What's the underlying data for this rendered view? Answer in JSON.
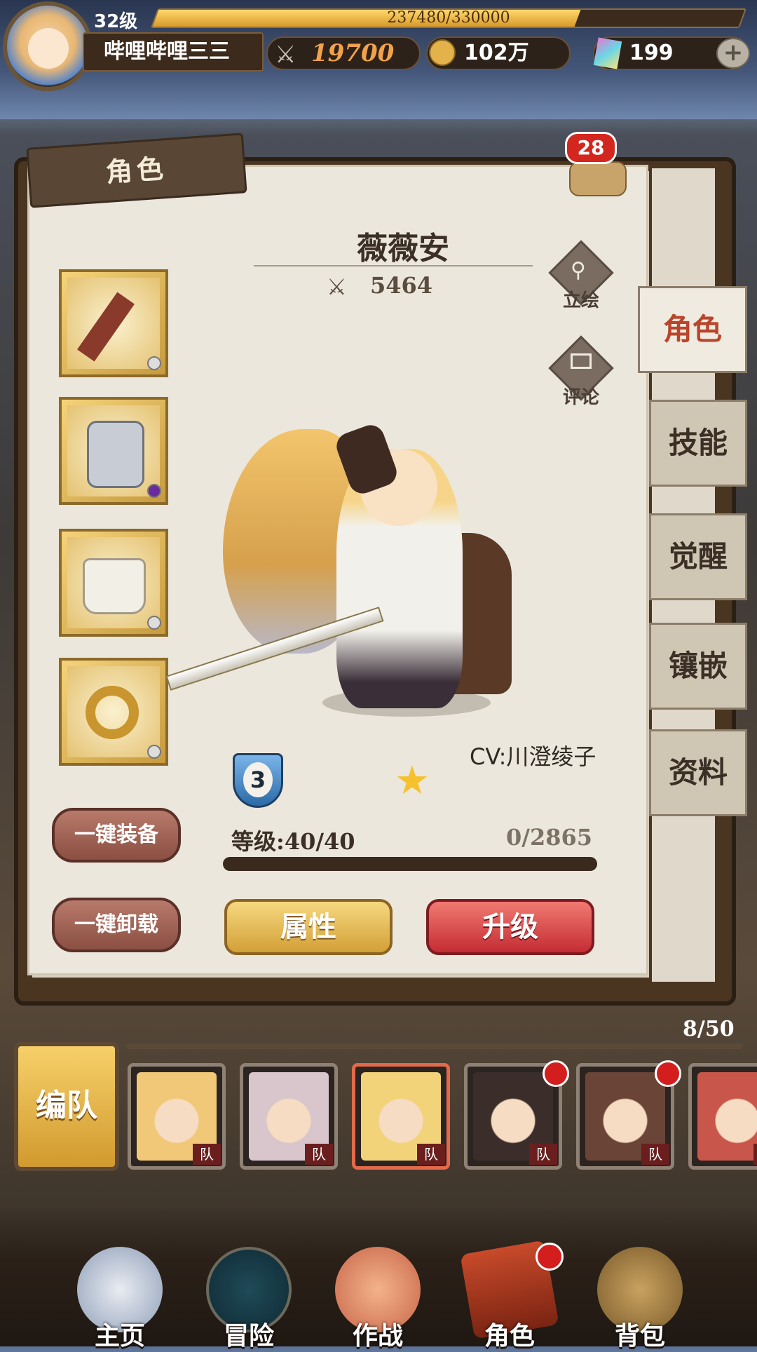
{
  "player": {
    "level": "32级",
    "exp_text": "237480/330000",
    "exp_fraction": 0.72,
    "name": "哔哩哔哩三三",
    "power": "19700",
    "gold": "102万",
    "gems": "199",
    "plus_label": "+"
  },
  "panel": {
    "title": "角色",
    "comment_count": "28",
    "char_name": "薇薇安",
    "char_power": "5464",
    "portrait_label": "立绘",
    "comment_label": "评论",
    "cv": "CV:川澄绫子",
    "rank": "3",
    "stars": 1,
    "level_text": "等级:40/40",
    "exp_text": "0/2865",
    "btn_equip_all": "一键装备",
    "btn_unequip_all": "一键卸载",
    "btn_attributes": "属性",
    "btn_upgrade": "升级"
  },
  "side_tabs": [
    "角色",
    "技能",
    "觉醒",
    "镶嵌",
    "资料"
  ],
  "roster": {
    "count": "8/50",
    "team_button": "编队",
    "team_tag": "队",
    "heroes": [
      {
        "color": "#f0c878",
        "badge": false,
        "selected": false
      },
      {
        "color": "#d8c6cc",
        "badge": false,
        "selected": false
      },
      {
        "color": "#f2d37a",
        "badge": false,
        "selected": true
      },
      {
        "color": "#3b2e2a",
        "badge": true,
        "selected": false
      },
      {
        "color": "#6a4436",
        "badge": true,
        "selected": false
      },
      {
        "color": "#c9564a",
        "badge": false,
        "selected": false
      }
    ]
  },
  "bottom_nav": [
    "主页",
    "冒险",
    "作战",
    "角色",
    "背包"
  ],
  "colors": {
    "accent_gold": "#f3a24a",
    "upgrade_red": "#c42c33",
    "badge_red": "#d41e1e"
  }
}
